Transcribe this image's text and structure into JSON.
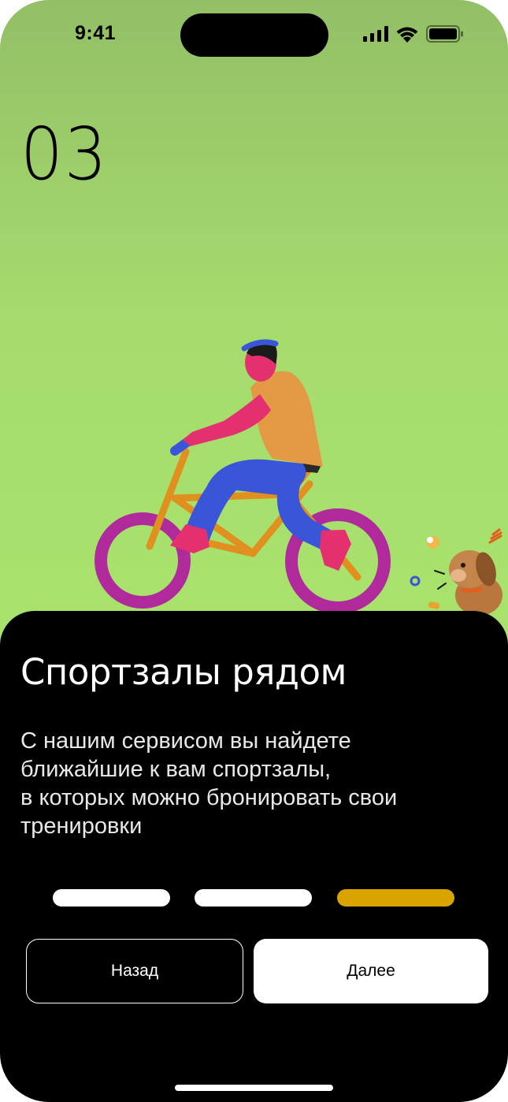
{
  "status_bar": {
    "time": "9:41",
    "icons": [
      "cellular-signal-icon",
      "wifi-icon",
      "battery-icon"
    ]
  },
  "onboarding": {
    "step_number": "03",
    "title": "Спортзалы рядом",
    "description_lines": [
      "С нашим сервисом вы найдете",
      "ближайшие к вам спортзалы,",
      "в которых можно бронировать свои",
      "тренировки"
    ],
    "page_indicator": {
      "total": 3,
      "active": 3
    }
  },
  "buttons": {
    "back_label": "Назад",
    "next_label": "Далее"
  },
  "colors": {
    "background_green": "#a8e36c",
    "sheet": "#000000",
    "accent": "#d9a400",
    "bike_wheel": "#b02a9c",
    "bike_frame": "#e0901e",
    "shirt": "#e49a45",
    "pants": "#3a55d8",
    "skin": "#e4306e"
  }
}
